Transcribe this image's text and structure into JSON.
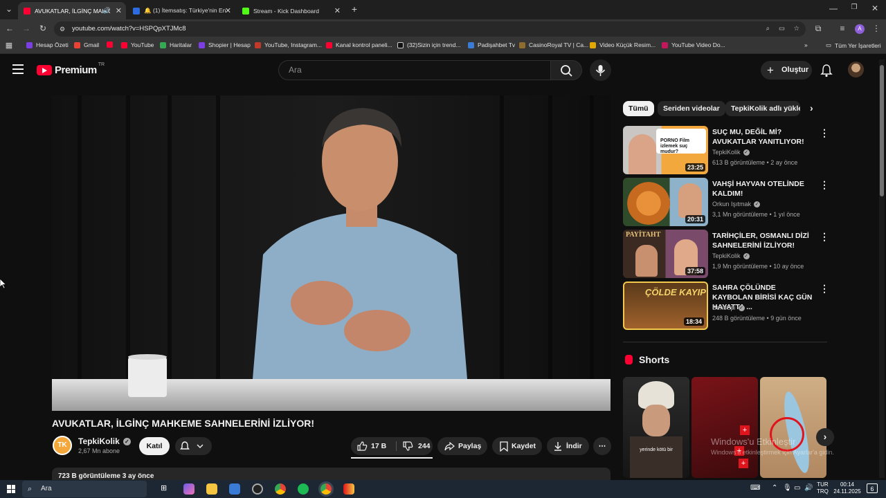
{
  "browser": {
    "tabs": [
      {
        "title": "AVUKATLAR, İLGİNÇ MAHK",
        "active": true,
        "favicon_color": "#ff0033"
      },
      {
        "title": "🔔 (1) İtemsatış: Türkiye'nin En",
        "active": false,
        "favicon_color": "#2d6cdf"
      },
      {
        "title": "Stream - Kick Dashboard",
        "active": false,
        "favicon_color": "#53fc18"
      }
    ],
    "url": "youtube.com/watch?v=HSPQpXTJMc8",
    "bookmarks": [
      {
        "label": "Hesap Özeti",
        "color": "#7b3fe4"
      },
      {
        "label": "Gmail",
        "color": "#ea4335"
      },
      {
        "label": "",
        "color": "#ff0033"
      },
      {
        "label": "YouTube",
        "color": "#ff0033"
      },
      {
        "label": "Haritalar",
        "color": "#34a853"
      },
      {
        "label": "Shopier | Hesap",
        "color": "#7b3fe4"
      },
      {
        "label": "YouTube, Instagram...",
        "color": "#c0392b"
      },
      {
        "label": "Kanal kontrol paneli...",
        "color": "#ff0033"
      },
      {
        "label": "(32)Sizin için trend...",
        "color": "#111111"
      },
      {
        "label": "Padişahbet Tv",
        "color": "#3a7bd5"
      },
      {
        "label": "CasinoRoyal TV | Ca...",
        "color": "#8e6b2f"
      },
      {
        "label": "Video Küçük Resim...",
        "color": "#e0a800"
      },
      {
        "label": "YouTube Video Do...",
        "color": "#c2185b"
      }
    ],
    "all_bookmarks": "Tüm Yer İşaretleri"
  },
  "youtube": {
    "logo_text": "Premium",
    "region": "TR",
    "search_placeholder": "Ara",
    "create_label": "Oluştur",
    "video_title": "AVUKATLAR, İLGİNÇ MAHKEME SAHNELERİNİ İZLİYOR!",
    "channel": {
      "name": "TepkiKolik",
      "subs": "2,67 Mn abone",
      "avatar_text": "TK"
    },
    "join_label": "Katıl",
    "likes": "17 B",
    "dislikes": "244",
    "share_label": "Paylaş",
    "save_label": "Kaydet",
    "download_label": "İndir",
    "desc_partial": "723 B görüntüleme  3 ay önce",
    "chips": [
      "Tümü",
      "Seriden videolar",
      "TepkiKolik adlı yükle"
    ],
    "recommendations": [
      {
        "title": "SUÇ MU, DEĞİL Mİ? AVUKATLAR YANITLIYOR!",
        "channel": "TepkiKolik",
        "meta": "613 B görüntüleme • 2 ay önce",
        "duration": "23:25",
        "thumb_note": "PORNO Film izlemek suç mudur?"
      },
      {
        "title": "VAHŞİ HAYVAN OTELİNDE KALDIM!",
        "channel": "Orkun Işıtmak",
        "meta": "3,1 Mn görüntüleme • 1 yıl önce",
        "duration": "20:31"
      },
      {
        "title": "TARİHÇİLER, OSMANLI DİZİ SAHNELERİNİ İZLİYOR!",
        "channel": "TepkiKolik",
        "meta": "1,9 Mn görüntüleme • 10 ay önce",
        "duration": "37:58",
        "thumb_note": "PAYİTAHT"
      },
      {
        "title": "SAHRA ÇÖLÜNDE KAYBOLAN BİRİSİ KAÇ GÜN HAYATTA ...",
        "channel": "Bentropi",
        "meta": "248 B görüntüleme • 9 gün önce",
        "duration": "18:34",
        "thumb_note": "ÇÖLDE KAYIP"
      }
    ],
    "shorts_title": "Shorts",
    "shorts": [
      {
        "caption": "yerinde kötü bir"
      },
      {
        "caption": ""
      },
      {
        "caption": ""
      }
    ],
    "activate_windows": "Windows'u Etkinleştir",
    "activate_windows_sub": "Windows'u etkinleştirmek için Ayarlar'a gidin."
  },
  "taskbar": {
    "search": "Ara",
    "lang": "TUR",
    "lang2": "TRQ",
    "time": "00:14",
    "date": "24.11.2025",
    "notif": "6"
  }
}
